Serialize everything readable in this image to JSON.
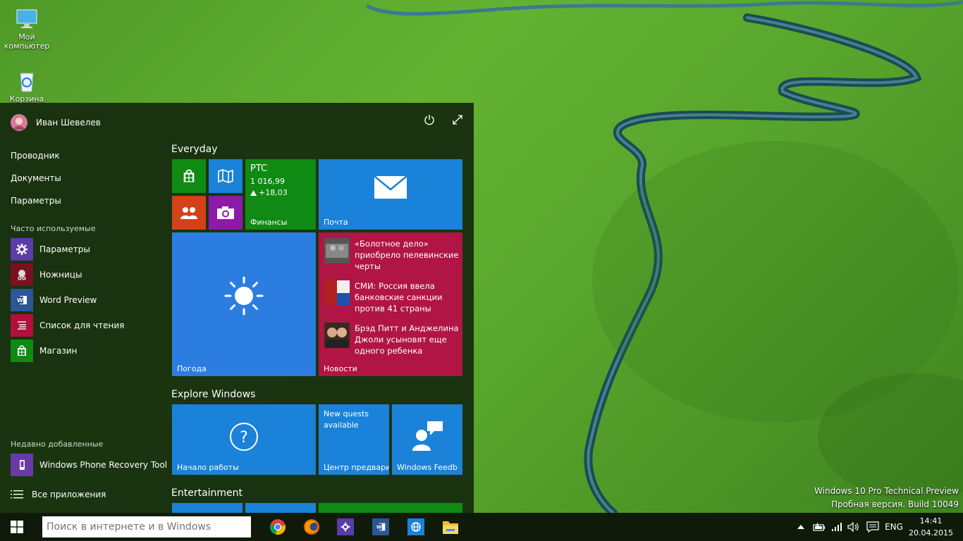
{
  "desktop": {
    "icons": [
      {
        "label_line1": "Мой",
        "label_line2": "компьютер",
        "icon": "computer-icon"
      },
      {
        "label_line1": "Корзина",
        "icon": "recycle-bin-icon"
      }
    ],
    "watermark": {
      "line1": "Windows 10 Pro Technical Preview",
      "line2": "Пробная версия. Build 10049"
    }
  },
  "start_menu": {
    "user_name": "Иван Шевелев",
    "places": [
      "Проводник",
      "Документы",
      "Параметры"
    ],
    "most_used_label": "Часто используемые",
    "most_used": [
      {
        "label": "Параметры",
        "icon": "gear-icon",
        "color": "#5b3ca8"
      },
      {
        "label": "Ножницы",
        "icon": "scissors-icon",
        "color": "#7a1020"
      },
      {
        "label": "Word Preview",
        "icon": "word-icon",
        "color": "#2b5797"
      },
      {
        "label": "Список для чтения",
        "icon": "reading-list-icon",
        "color": "#b0103a"
      },
      {
        "label": "Магазин",
        "icon": "store-icon",
        "color": "#0f8a12"
      }
    ],
    "recent_label": "Недавно добавленные",
    "recent": [
      {
        "label": "Windows Phone Recovery Tool",
        "icon": "phone-recovery-icon",
        "color": "#6a3aa8"
      }
    ],
    "all_apps_label": "Все приложения",
    "groups": {
      "everyday": "Everyday",
      "explore": "Explore Windows",
      "entertainment": "Entertainment"
    },
    "tiles": {
      "finance": {
        "ticker": "PTC",
        "value": "1 016,99",
        "change": "+18,03",
        "label": "Финансы",
        "color": "#0f8a12"
      },
      "mail": {
        "label": "Почта",
        "color": "#1a82d8"
      },
      "weather": {
        "label": "Погода",
        "color": "#2c7de0"
      },
      "news": {
        "label": "Новости",
        "color": "#b01545",
        "items": [
          "«Болотное дело» приобрело пелевинские черты",
          "СМИ: Россия ввела банковские санкции против 41 страны",
          "Брэд Питт и Анджелина Джоли усыновят еще одного ребенка"
        ]
      },
      "get_started": {
        "label": "Начало работы",
        "color": "#1a82d8"
      },
      "quests": {
        "line1": "New quests",
        "line2": "available",
        "label": "Центр предвари",
        "color": "#1a82d8"
      },
      "feedback": {
        "label": "Windows Feedb",
        "color": "#1a82d8"
      },
      "small": [
        {
          "icon": "store-icon",
          "color": "#0f8a12"
        },
        {
          "icon": "maps-icon",
          "color": "#1a82d8"
        },
        {
          "icon": "people-icon",
          "color": "#d4421a"
        },
        {
          "icon": "camera-icon",
          "color": "#8d1aa8"
        }
      ]
    }
  },
  "taskbar": {
    "search_placeholder": "Поиск в интернете и в Windows",
    "apps": [
      {
        "icon": "chrome-icon"
      },
      {
        "icon": "firefox-icon"
      },
      {
        "icon": "settings-icon",
        "color": "#5b3ca8"
      },
      {
        "icon": "word-icon",
        "color": "#2b5797"
      },
      {
        "icon": "ie-icon",
        "color": "#1a82d8"
      },
      {
        "icon": "file-explorer-icon",
        "color": "#f0c030"
      }
    ],
    "language": "ENG",
    "time": "14:41",
    "date": "20.04.2015"
  }
}
